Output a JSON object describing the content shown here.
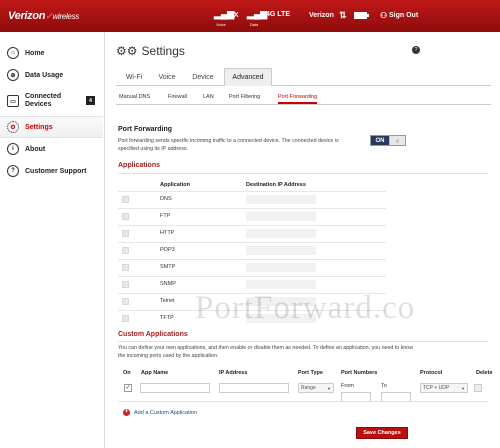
{
  "header": {
    "brand": "Verizon",
    "brand_sub": "wireless",
    "signal_label": "Voice",
    "network_1x": "1X",
    "data_label": "Data",
    "network_4g": "4G LTE",
    "carrier": "Verizon",
    "sign_out": "Sign Out"
  },
  "sidebar": {
    "items": [
      {
        "label": "Home",
        "icon": "home-icon"
      },
      {
        "label": "Data Usage",
        "icon": "globe-icon"
      },
      {
        "label": "Connected Devices",
        "icon": "devices-icon",
        "badge": "4"
      },
      {
        "label": "Settings",
        "icon": "gear-icon",
        "active": true
      },
      {
        "label": "About",
        "icon": "info-icon"
      },
      {
        "label": "Customer Support",
        "icon": "question-icon"
      }
    ]
  },
  "page": {
    "title": "Settings",
    "help": "?"
  },
  "tabs": [
    "Wi-Fi",
    "Voice",
    "Device",
    "Advanced"
  ],
  "subtabs": [
    "Manual DNS",
    "Firewall",
    "LAN",
    "Port Filtering",
    "Port Forwarding"
  ],
  "port_forwarding": {
    "title": "Port Forwarding",
    "description": "Port forwarding sends specific incoming traffic to a connected device. The connected device is specified using its IP address.",
    "toggle_on": "ON",
    "toggle_off": "|||"
  },
  "applications": {
    "title": "Applications",
    "headers": {
      "application": "Application",
      "ip": "Destination IP Address"
    },
    "rows": [
      "DNS",
      "FTP",
      "HTTP",
      "POP3",
      "SMTP",
      "SNMP",
      "Telnet",
      "TFTP"
    ]
  },
  "custom": {
    "title": "Custom Applications",
    "description": "You can define your own applications, and then enable or disable them as needed. To define an application, you need to know the incoming ports used by the application.",
    "headers": {
      "on": "On",
      "app_name": "App Name",
      "ip": "IP Address",
      "port_type": "Port Type",
      "port_numbers": "Port Numbers",
      "protocol": "Protocol",
      "delete": "Delete"
    },
    "port_type_value": "Range",
    "from_label": "From",
    "to_label": "To",
    "protocol_value": "TCP + UDP",
    "checked_mark": "✓",
    "add_label": "Add a Custom Application",
    "plus": "+"
  },
  "save_label": "Save Changes",
  "watermark": "PortForward.co"
}
